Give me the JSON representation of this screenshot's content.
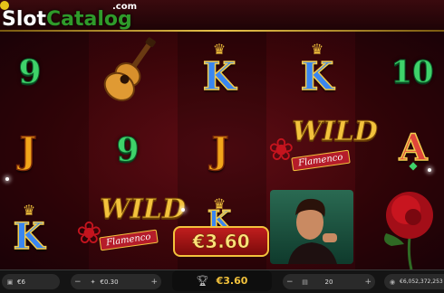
{
  "watermark": {
    "slot": "Slot",
    "catalog": "Catalog",
    "com": ".com"
  },
  "reels": {
    "r1": [
      "9",
      "J",
      "K"
    ],
    "r2": [
      "guitar-icon",
      "9",
      "WILD"
    ],
    "r3": [
      "K",
      "J",
      "K"
    ],
    "r4": [
      "K",
      "WILD",
      "dancer"
    ],
    "r5": [
      "10",
      "A",
      "rose-icon"
    ]
  },
  "wild": {
    "word": "WILD",
    "banner": "Flamenco"
  },
  "win_popup": "€3.60",
  "bottom": {
    "balance": "€6",
    "bet": "€0.30",
    "total_win": "€3.60",
    "autoplay": "20",
    "jackpot": "€6,052,372,253"
  },
  "colors": {
    "accent_gold": "#f3c23c",
    "win_red": "#c01e1e",
    "background": "#3a0509"
  }
}
